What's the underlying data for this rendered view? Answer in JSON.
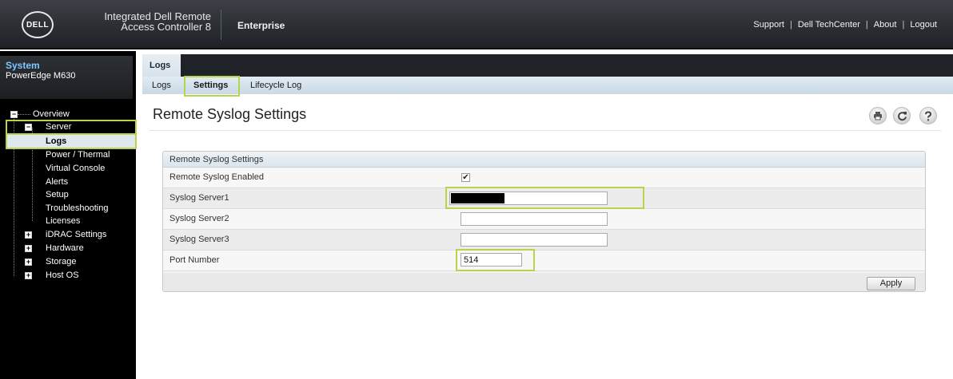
{
  "header": {
    "product_line1": "Integrated Dell Remote",
    "product_line2": "Access Controller 8",
    "edition": "Enterprise",
    "logo_text": "DELL",
    "links": [
      "Support",
      "Dell TechCenter",
      "About",
      "Logout"
    ],
    "link_separator": "|"
  },
  "sidebar": {
    "system_title": "System",
    "system_model": "PowerEdge M630",
    "tree": {
      "overview": "Overview",
      "server": "Server",
      "server_children": [
        "Logs",
        "Power / Thermal",
        "Virtual Console",
        "Alerts",
        "Setup",
        "Troubleshooting",
        "Licenses"
      ],
      "collapsed": [
        "iDRAC Settings",
        "Hardware",
        "Storage",
        "Host OS"
      ],
      "expanded_toggle": "−",
      "collapsed_toggle": "+"
    }
  },
  "tabs": {
    "main": "Logs",
    "sub": [
      "Logs",
      "Settings",
      "Lifecycle Log"
    ],
    "active_sub": "Settings"
  },
  "page": {
    "title": "Remote Syslog Settings",
    "icons": [
      "print-icon",
      "refresh-icon",
      "help-icon"
    ]
  },
  "panel": {
    "title": "Remote Syslog Settings",
    "rows": {
      "enabled_label": "Remote Syslog Enabled",
      "enabled_checked": true,
      "server1_label": "Syslog Server1",
      "server2_label": "Syslog Server2",
      "server2_value": "",
      "server3_label": "Syslog Server3",
      "server3_value": "",
      "port_label": "Port Number",
      "port_value": "514"
    },
    "apply_label": "Apply"
  },
  "colors": {
    "highlight": "#b7d44a",
    "header_bg": "#2b2e33",
    "sidebar_bg": "#000000",
    "system_title": "#7ec8ff"
  }
}
